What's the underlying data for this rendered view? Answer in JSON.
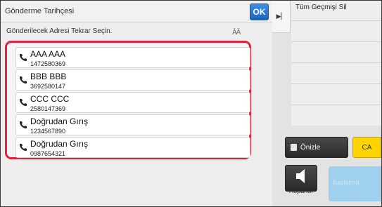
{
  "header": {
    "title": "Gönderme Tarihçesi",
    "ok_label": "OK",
    "subtitle": "Gönderilecek Adresi Tekrar Seçin."
  },
  "list": {
    "items": [
      {
        "name": "AAA AAA",
        "number": "1472580369"
      },
      {
        "name": "BBB BBB",
        "number": "3692580147"
      },
      {
        "name": "CCC CCC",
        "number": "2580147369"
      },
      {
        "name": "Doğrudan Gırış",
        "number": "1234567890"
      },
      {
        "name": "Doğrudan Gırış",
        "number": "0987654321"
      }
    ]
  },
  "right_panel": {
    "history_title": "Tüm Geçmişi Sil",
    "preview_label": "Önizle",
    "ca_label": "CA",
    "speaker_label": "Hoparlör",
    "start_label": "Başlatma"
  },
  "colors": {
    "highlight_border": "#e1223c",
    "ok_blue": "#1b64c0",
    "ca_yellow": "#ffd400",
    "start_blue": "#9fd0ef"
  }
}
